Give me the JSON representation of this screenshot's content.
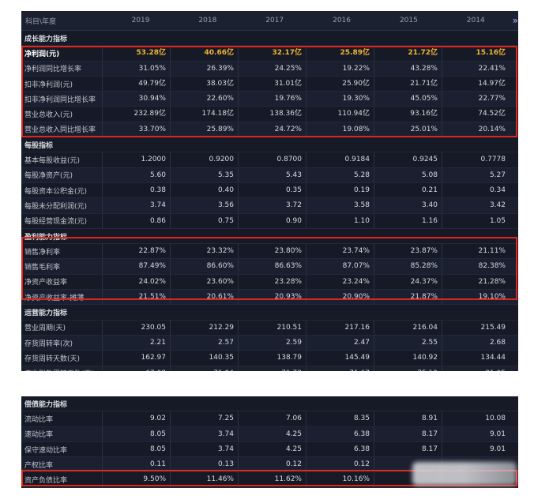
{
  "header": {
    "col0": "科目\\年度",
    "years": [
      "2019",
      "2018",
      "2017",
      "2016",
      "2015",
      "2014"
    ],
    "more_icon": "double-chevron-right"
  },
  "panel1": {
    "sections": [
      {
        "title": "成长能力指标",
        "rows": [
          {
            "label": "净利润(元)",
            "bold": true,
            "values": [
              "53.28亿",
              "40.66亿",
              "32.17亿",
              "25.89亿",
              "21.72亿",
              "15.16亿"
            ]
          },
          {
            "label": "净利润同比增长率",
            "values": [
              "31.05%",
              "26.39%",
              "24.25%",
              "19.22%",
              "43.28%",
              "22.41%"
            ]
          },
          {
            "label": "扣非净利润(元)",
            "values": [
              "49.79亿",
              "38.03亿",
              "31.01亿",
              "25.90亿",
              "21.71亿",
              "14.97亿"
            ]
          },
          {
            "label": "扣非净利润同比增长率",
            "values": [
              "30.94%",
              "22.60%",
              "19.76%",
              "19.30%",
              "45.05%",
              "22.77%"
            ]
          },
          {
            "label": "营业总收入(元)",
            "values": [
              "232.89亿",
              "174.18亿",
              "138.36亿",
              "110.94亿",
              "93.16亿",
              "74.52亿"
            ]
          },
          {
            "label": "营业总收入同比增长率",
            "values": [
              "33.70%",
              "25.89%",
              "24.72%",
              "19.08%",
              "25.01%",
              "20.14%"
            ]
          }
        ]
      },
      {
        "title": "每股指标",
        "rows": [
          {
            "label": "基本每股收益(元)",
            "values": [
              "1.2000",
              "0.9200",
              "0.8700",
              "0.9184",
              "0.9245",
              "0.7778"
            ]
          },
          {
            "label": "每股净资产(元)",
            "values": [
              "5.60",
              "5.35",
              "5.43",
              "5.28",
              "5.08",
              "5.27"
            ]
          },
          {
            "label": "每股资本公积金(元)",
            "values": [
              "0.38",
              "0.40",
              "0.35",
              "0.19",
              "0.21",
              "0.34"
            ]
          },
          {
            "label": "每股未分配利润(元)",
            "values": [
              "3.74",
              "3.56",
              "3.72",
              "3.58",
              "3.40",
              "3.42"
            ]
          },
          {
            "label": "每股经营现金流(元)",
            "values": [
              "0.86",
              "0.75",
              "0.90",
              "1.10",
              "1.16",
              "1.05"
            ]
          }
        ]
      },
      {
        "title": "盈利能力指标",
        "rows": [
          {
            "label": "销售净利率",
            "values": [
              "22.87%",
              "23.32%",
              "23.80%",
              "23.74%",
              "23.87%",
              "21.11%"
            ]
          },
          {
            "label": "销售毛利率",
            "values": [
              "87.49%",
              "86.60%",
              "86.63%",
              "87.07%",
              "85.28%",
              "82.38%"
            ]
          },
          {
            "label": "净资产收益率",
            "values": [
              "24.02%",
              "23.60%",
              "23.28%",
              "23.24%",
              "24.37%",
              "21.28%"
            ]
          },
          {
            "label": "净资产收益率-摊薄",
            "values": [
              "21.51%",
              "20.61%",
              "20.93%",
              "20.90%",
              "21.87%",
              "19.10%"
            ]
          }
        ]
      },
      {
        "title": "运营能力指标",
        "rows": [
          {
            "label": "营业周期(天)",
            "values": [
              "230.05",
              "212.29",
              "210.51",
              "217.16",
              "216.04",
              "215.49"
            ]
          },
          {
            "label": "存货周转率(次)",
            "values": [
              "2.21",
              "2.57",
              "2.59",
              "2.47",
              "2.55",
              "2.68"
            ]
          },
          {
            "label": "存货周转天数(天)",
            "values": [
              "162.97",
              "140.35",
              "138.79",
              "145.49",
              "140.92",
              "134.44"
            ]
          },
          {
            "label": "应收账款周转天数(天)",
            "values": [
              "67.08",
              "71.94",
              "71.73",
              "71.67",
              "75.12",
              "81.05"
            ]
          }
        ]
      }
    ]
  },
  "panel2": {
    "sections": [
      {
        "title": "偿债能力指标",
        "rows": [
          {
            "label": "流动比率",
            "values": [
              "9.02",
              "7.25",
              "7.06",
              "8.35",
              "8.91",
              "10.08"
            ]
          },
          {
            "label": "速动比率",
            "values": [
              "8.05",
              "3.74",
              "4.25",
              "6.38",
              "8.17",
              "9.01"
            ]
          },
          {
            "label": "保守速动比率",
            "values": [
              "8.05",
              "3.74",
              "4.25",
              "6.38",
              "8.17",
              "9.01"
            ]
          },
          {
            "label": "产权比率",
            "values": [
              "0.11",
              "0.13",
              "0.12",
              "0.12",
              "",
              ""
            ]
          },
          {
            "label": "资产负债比率",
            "values": [
              "9.50%",
              "11.46%",
              "11.62%",
              "10.16%",
              "",
              ""
            ]
          }
        ]
      }
    ]
  }
}
